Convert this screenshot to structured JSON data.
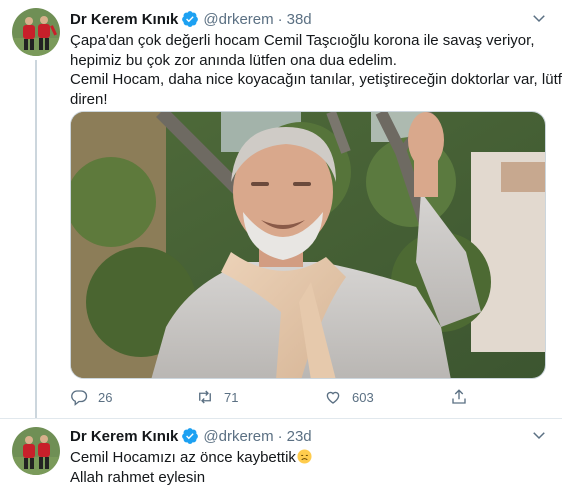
{
  "tweets": [
    {
      "author": {
        "name": "Dr Kerem Kınık",
        "handle": "@drkerem",
        "verified": true
      },
      "time": "38d",
      "text_lines": [
        "Çapa'dan çok değerli hocam Cemil Taşcıoğlu korona ile savaş veriyor,",
        "hepimiz bu çok zor anında lütfen ona dua edelim.",
        "Cemil Hocam, daha nice koyacağın tanılar, yetiştireceğin doktorlar var, lütfen",
        "diren!"
      ],
      "actions": {
        "replies": "26",
        "retweets": "71",
        "likes": "603"
      }
    },
    {
      "author": {
        "name": "Dr Kerem Kınık",
        "handle": "@drkerem",
        "verified": true
      },
      "time": "23d",
      "text_lines": [
        "Cemil Hocamızı az önce kaybettik",
        "Allah rahmet eylesin"
      ],
      "emoji": "disappointed-face"
    }
  ],
  "separator": "·",
  "colors": {
    "verified": "#1da1f2",
    "muted": "#5b7083",
    "border": "#e1e8ed"
  }
}
